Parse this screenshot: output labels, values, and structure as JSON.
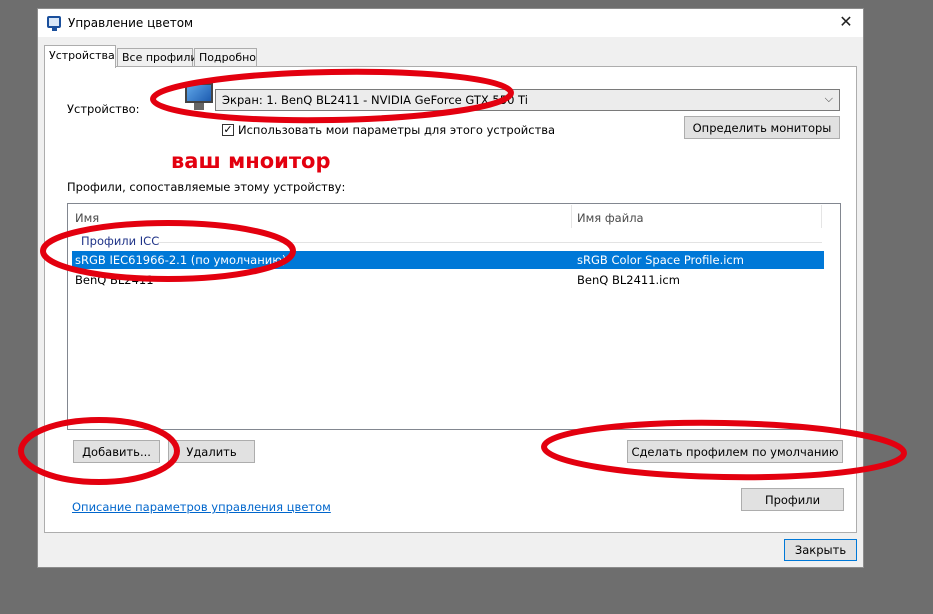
{
  "window": {
    "title": "Управление цветом",
    "close_symbol": "✕"
  },
  "tabs": [
    {
      "label": "Устройства",
      "active": true
    },
    {
      "label": "Все профили",
      "active": false
    },
    {
      "label": "Подробно",
      "active": false
    }
  ],
  "device": {
    "label": "Устройство:",
    "selected": "Экран: 1. BenQ BL2411 - NVIDIA GeForce GTX 550 Ti",
    "arrow": "⌵",
    "checkbox_checked": true,
    "checkbox_mark": "✓",
    "checkbox_label": "Использовать мои параметры для этого устройства",
    "identify_button": "Определить мониторы"
  },
  "annotation": {
    "text": "ваш мноитор",
    "color": "#e3000f"
  },
  "profiles": {
    "label": "Профили, сопоставляемые этому устройству:",
    "columns": [
      "Имя",
      "Имя файла"
    ],
    "group": "Профили ICC",
    "rows": [
      {
        "name": "sRGB IEC61966-2.1 (по умолчанию)",
        "file": "sRGB Color Space Profile.icm",
        "selected": true
      },
      {
        "name": "BenQ BL2411",
        "file": "BenQ BL2411.icm",
        "selected": false
      }
    ]
  },
  "buttons": {
    "add": "Добавить...",
    "remove": "Удалить",
    "set_default": "Сделать профилем по умолчанию",
    "profiles": "Профили",
    "close": "Закрыть"
  },
  "link": "Описание параметров управления цветом",
  "colors": {
    "selection": "#0078d7",
    "link": "#0066cc",
    "marker": "#e3000f"
  }
}
